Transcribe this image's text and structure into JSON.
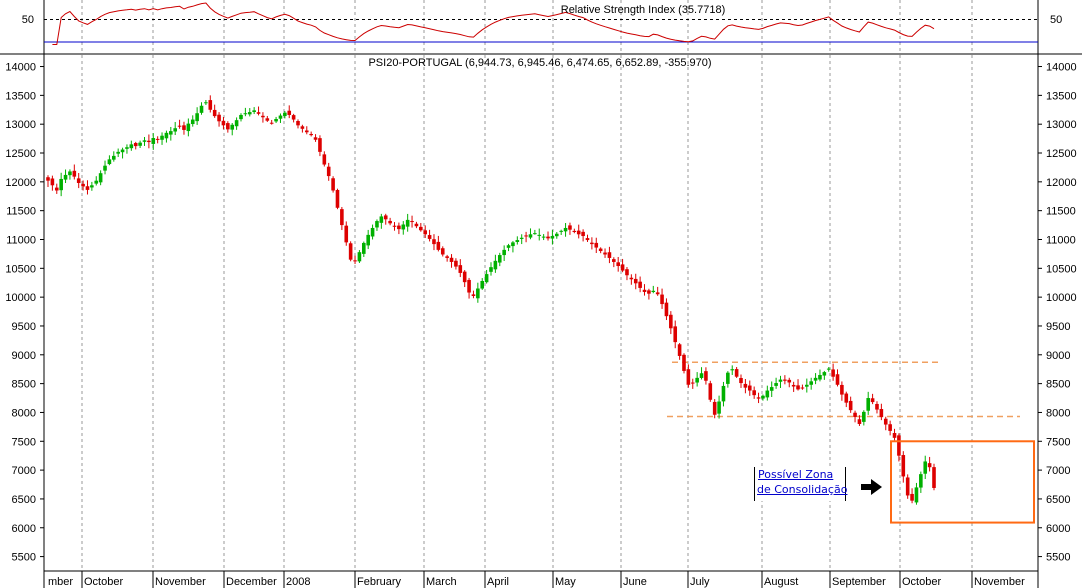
{
  "rsi_panel": {
    "title": "Relative Strength Index (35.7718)",
    "axis_label": "50",
    "value": 35.7718
  },
  "price_panel": {
    "title": "PSI20-PORTUGAL (6,944.73, 6,945.46, 6,474.65, 6,652.89, -355.970)"
  },
  "annotation": {
    "line1": "Possível Zona",
    "line2": "de Consolidação",
    "arrow_icon": "right-arrow-icon"
  },
  "colors": {
    "up_candle": "#00b000",
    "down_candle": "#dd0000",
    "rsi_line": "#cc0000",
    "rsi_reference": "#0000cc",
    "highlight_box": "#ff6a14",
    "support_resistance": "#f0a060"
  },
  "chart_data": {
    "type": "candlestick",
    "y_ticks": [
      14000,
      13500,
      13000,
      12500,
      12000,
      11500,
      11000,
      10500,
      10000,
      9500,
      9000,
      8500,
      8000,
      7500,
      7000,
      6500,
      6000,
      5500
    ],
    "ylim": [
      5250,
      14200
    ],
    "x_labels": [
      "mber",
      "October",
      "November",
      "December",
      "2008",
      "February",
      "March",
      "April",
      "May",
      "June",
      "July",
      "August",
      "September",
      "October",
      "November"
    ],
    "grid": true,
    "closes": [
      12020,
      11940,
      11850,
      12050,
      12120,
      12180,
      12090,
      11980,
      11920,
      11860,
      11940,
      12020,
      12150,
      12280,
      12390,
      12450,
      12520,
      12560,
      12600,
      12650,
      12620,
      12680,
      12720,
      12690,
      12760,
      12730,
      12800,
      12850,
      12880,
      12930,
      12960,
      12900,
      13010,
      13080,
      13190,
      13320,
      13380,
      13250,
      13140,
      13050,
      12980,
      12910,
      12990,
      13070,
      13160,
      13190,
      13210,
      13240,
      13180,
      13120,
      13060,
      13020,
      13090,
      13150,
      13200,
      13160,
      13080,
      12980,
      12920,
      12860,
      12810,
      12730,
      12520,
      12300,
      12100,
      11850,
      11550,
      11250,
      10950,
      10650,
      10620,
      10780,
      10940,
      11080,
      11200,
      11320,
      11400,
      11350,
      11280,
      11220,
      11180,
      11260,
      11340,
      11310,
      11230,
      11160,
      11090,
      11010,
      10920,
      10820,
      10740,
      10680,
      10610,
      10530,
      10420,
      10260,
      10080,
      10020,
      10150,
      10280,
      10400,
      10520,
      10630,
      10730,
      10820,
      10900,
      10950,
      10990,
      11030,
      11060,
      11090,
      11110,
      11080,
      11050,
      11020,
      11060,
      11100,
      11150,
      11200,
      11170,
      11130,
      11090,
      11060,
      10990,
      10920,
      10860,
      10800,
      10740,
      10680,
      10610,
      10540,
      10460,
      10380,
      10310,
      10240,
      10160,
      10090,
      10060,
      10110,
      10050,
      9880,
      9670,
      9460,
      9220,
      8980,
      8720,
      8480,
      8510,
      8600,
      8680,
      8550,
      8220,
      7960,
      8190,
      8460,
      8690,
      8750,
      8620,
      8510,
      8430,
      8380,
      8300,
      8240,
      8290,
      8380,
      8440,
      8510,
      8570,
      8550,
      8520,
      8450,
      8400,
      8420,
      8480,
      8540,
      8600,
      8650,
      8700,
      8760,
      8620,
      8480,
      8310,
      8170,
      8040,
      7920,
      7800,
      8010,
      8250,
      8180,
      8050,
      7920,
      7790,
      7680,
      7560,
      7250,
      6890,
      6560,
      6470,
      6700,
      6930,
      7150,
      7050,
      6690
    ],
    "highlight_box": {
      "ymin": 6090,
      "ymax": 7500
    },
    "resistance_level": 8870,
    "support_level": 7930,
    "rsi_reference_levels": [
      50,
      30
    ]
  }
}
